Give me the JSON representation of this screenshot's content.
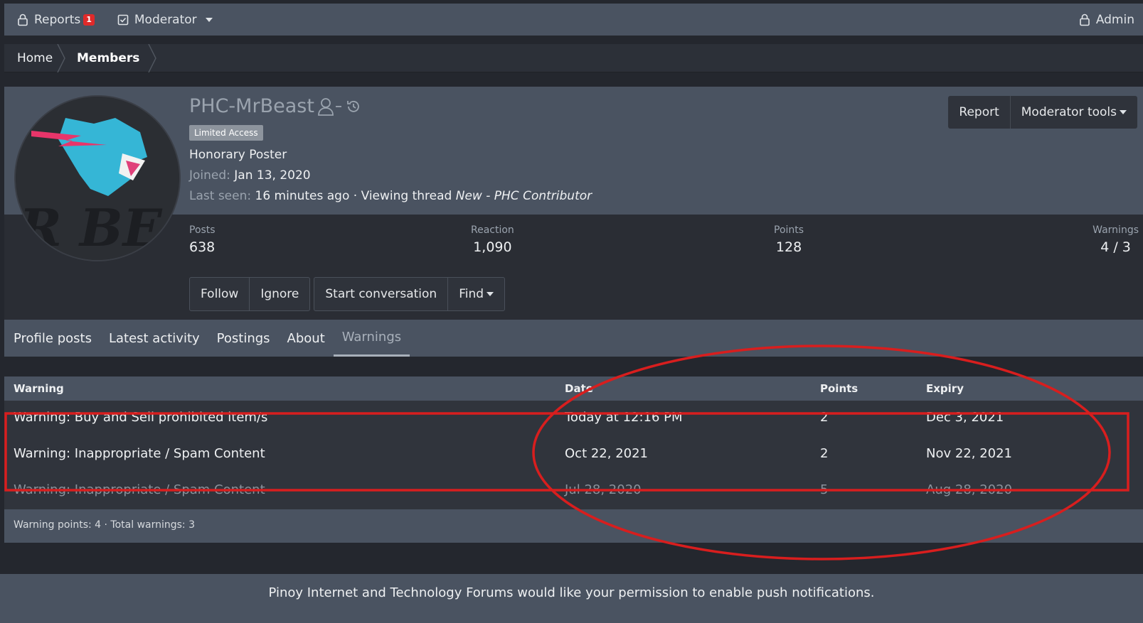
{
  "nav": {
    "reports_label": "Reports",
    "reports_count": "1",
    "moderator_label": "Moderator",
    "admin_label": "Admin"
  },
  "breadcrumb": {
    "home": "Home",
    "members": "Members"
  },
  "profile": {
    "username": "PHC-MrBeast",
    "tag": "Limited Access",
    "user_title": "Honorary Poster",
    "joined_label": "Joined:",
    "joined_value": "Jan 13, 2020",
    "last_seen_label": "Last seen:",
    "last_seen_value": "16 minutes ago · Viewing thread",
    "last_seen_thread": "New - PHC Contributor",
    "report_button": "Report",
    "moderator_tools_button": "Moderator tools"
  },
  "stats": [
    {
      "label": "Posts",
      "value": "638"
    },
    {
      "label": "Reaction",
      "value": "1,090"
    },
    {
      "label": "Points",
      "value": "128"
    },
    {
      "label": "Warnings",
      "value": "4 / 3"
    }
  ],
  "actions": {
    "follow": "Follow",
    "ignore": "Ignore",
    "start_conversation": "Start conversation",
    "find": "Find"
  },
  "tabs": [
    "Profile posts",
    "Latest activity",
    "Postings",
    "About",
    "Warnings"
  ],
  "warnings_table": {
    "headers": {
      "warning": "Warning",
      "date": "Date",
      "points": "Points",
      "expiry": "Expiry"
    },
    "rows": [
      {
        "warning": "Warning: Buy and Sell prohibited item/s",
        "date": "Today at 12:16 PM",
        "points": "2",
        "expiry": "Dec 3, 2021"
      },
      {
        "warning": "Warning: Inappropriate / Spam Content",
        "date": "Oct 22, 2021",
        "points": "2",
        "expiry": "Nov 22, 2021"
      },
      {
        "warning": "Warning: Inappropriate / Spam Content",
        "date": "Jul 28, 2020",
        "points": "5",
        "expiry": "Aug 28, 2020"
      }
    ],
    "footer": "Warning points: 4 · Total warnings: 3"
  },
  "push_notice": "Pinoy Internet and Technology Forums would like your permission to enable push notifications.",
  "colors": {
    "accent_red": "#e02a2a",
    "header_bg": "#4a5361",
    "page_bg": "#24272e"
  },
  "icons": [
    "lock-icon",
    "checkbox-icon",
    "user-minus-icon",
    "history-icon",
    "caret-down-icon"
  ]
}
